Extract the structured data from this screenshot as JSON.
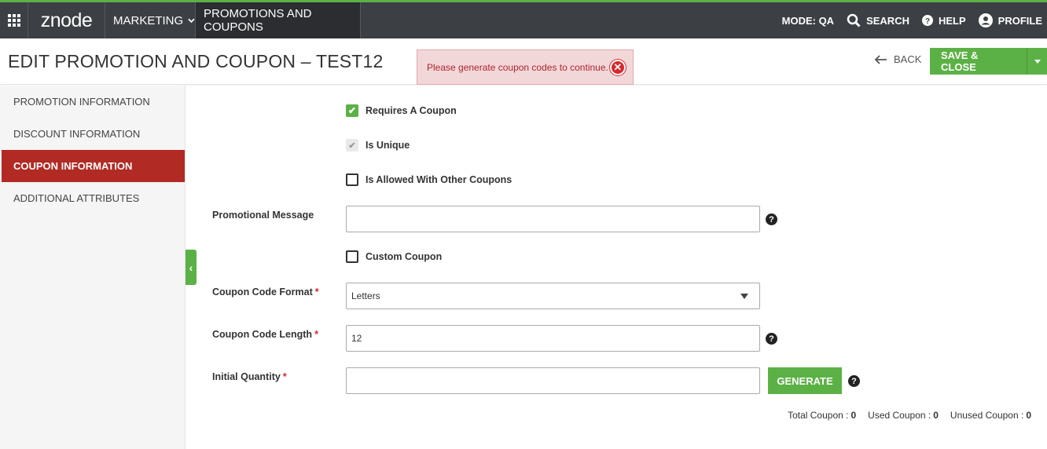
{
  "topbar": {
    "logo": "znode",
    "marketing": "MARKETING",
    "promotions": "PROMOTIONS AND COUPONS",
    "mode": "MODE: QA",
    "search": "SEARCH",
    "help": "HELP",
    "profile": "PROFILE"
  },
  "header": {
    "title": "EDIT PROMOTION AND COUPON  –  TEST12",
    "alert": "Please generate coupon codes to continue.",
    "back": "BACK",
    "save_close": "SAVE & CLOSE"
  },
  "sidebar": {
    "items": [
      {
        "label": "PROMOTION INFORMATION"
      },
      {
        "label": "DISCOUNT INFORMATION"
      },
      {
        "label": "COUPON INFORMATION"
      },
      {
        "label": "ADDITIONAL ATTRIBUTES"
      }
    ]
  },
  "form": {
    "requires_coupon": "Requires A Coupon",
    "is_unique": "Is Unique",
    "allowed_with_other": "Is Allowed With Other Coupons",
    "promotional_message_label": "Promotional Message",
    "promotional_message_value": "",
    "custom_coupon": "Custom Coupon",
    "code_format_label": "Coupon Code Format",
    "code_format_value": "Letters",
    "code_length_label": "Coupon Code Length",
    "code_length_value": "12",
    "initial_quantity_label": "Initial Quantity",
    "initial_quantity_value": "",
    "generate": "GENERATE",
    "required_mark": "*"
  },
  "totals": {
    "total_label": "Total Coupon :",
    "total_value": "0",
    "used_label": "Used Coupon :",
    "used_value": "0",
    "unused_label": "Unused Coupon :",
    "unused_value": "0"
  },
  "colors": {
    "accent_green": "#5cb146",
    "active_red": "#b22a24",
    "topbar": "#3c3f44"
  }
}
